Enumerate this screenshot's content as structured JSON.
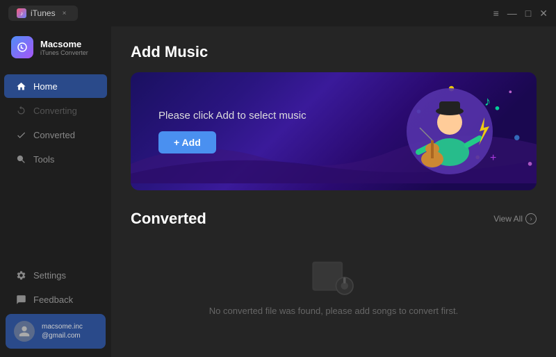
{
  "titlebar": {
    "tab_label": "iTunes",
    "tab_close": "×",
    "controls": {
      "menu": "≡",
      "minimize": "—",
      "maximize": "□",
      "close": "✕"
    }
  },
  "sidebar": {
    "logo": {
      "name": "Macsome",
      "subtitle": "iTunes Converter"
    },
    "nav_items": [
      {
        "id": "home",
        "label": "Home",
        "active": true,
        "disabled": false
      },
      {
        "id": "converting",
        "label": "Converting",
        "active": false,
        "disabled": true
      },
      {
        "id": "converted",
        "label": "Converted",
        "active": false,
        "disabled": false
      },
      {
        "id": "tools",
        "label": "Tools",
        "active": false,
        "disabled": false
      }
    ],
    "bottom_items": [
      {
        "id": "settings",
        "label": "Settings"
      },
      {
        "id": "feedback",
        "label": "Feedback"
      }
    ],
    "user": {
      "email_line1": "macsome.inc",
      "email_line2": "@gmail.com"
    }
  },
  "main": {
    "add_music": {
      "title": "Add Music",
      "banner_text": "Please click Add to select music",
      "add_button": "+ Add"
    },
    "converted": {
      "title": "Converted",
      "view_all": "View All",
      "empty_text": "No converted file was found, please add songs to convert first."
    }
  }
}
